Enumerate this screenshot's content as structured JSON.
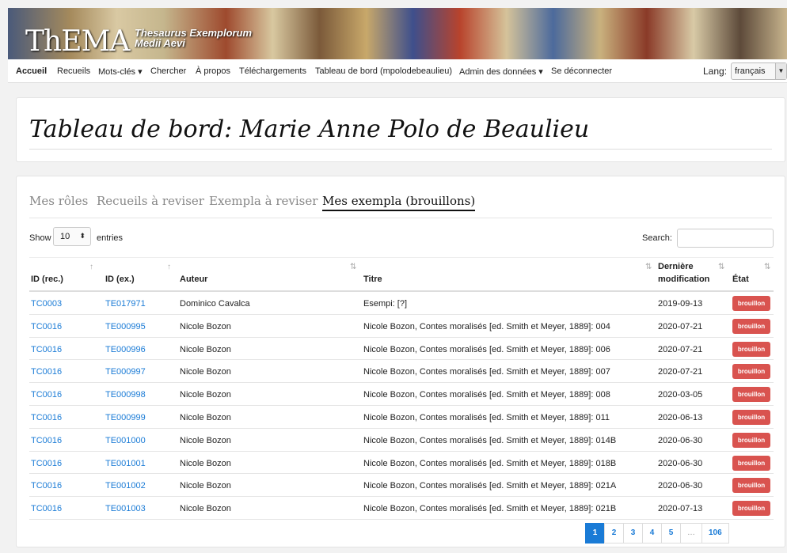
{
  "brand": {
    "logo": "ThEMA",
    "subtitle_line1": "Thesaurus Exemplorum",
    "subtitle_line2": "Medii Aevi"
  },
  "nav": {
    "items": [
      {
        "label": "Accueil",
        "active": true
      },
      {
        "label": "Recueils"
      },
      {
        "label": "Mots-clés ▾"
      },
      {
        "label": "Chercher"
      },
      {
        "label": "À propos"
      },
      {
        "label": "Téléchargements"
      },
      {
        "label": "Tableau de bord (mpolodebeaulieu)"
      },
      {
        "label": "Admin des données ▾"
      },
      {
        "label": "Se déconnecter"
      }
    ],
    "lang_label": "Lang:",
    "lang_value": "français"
  },
  "page_title": "Tableau de bord: Marie Anne Polo de Beaulieu",
  "tabs": [
    {
      "label": "Mes rôles"
    },
    {
      "label": "Recueils à reviser"
    },
    {
      "label": "Exempla à reviser"
    },
    {
      "label": "Mes exempla (brouillons)",
      "active": true
    }
  ],
  "table_controls": {
    "show_label": "Show",
    "entries_value": "10",
    "entries_label": "entries",
    "search_label": "Search:",
    "search_value": ""
  },
  "table": {
    "headers": [
      "ID (rec.)",
      "ID (ex.)",
      "Auteur",
      "Titre",
      "Dernière modification",
      "État"
    ],
    "rows": [
      {
        "rec": "TC0003",
        "ex": "TE017971",
        "auteur": "Dominico Cavalca",
        "titre": "Esempi: [?]",
        "date": "2019-09-13",
        "etat": "brouillon"
      },
      {
        "rec": "TC0016",
        "ex": "TE000995",
        "auteur": "Nicole Bozon",
        "titre": "Nicole Bozon, Contes moralisés [ed. Smith et Meyer, 1889]: 004",
        "date": "2020-07-21",
        "etat": "brouillon"
      },
      {
        "rec": "TC0016",
        "ex": "TE000996",
        "auteur": "Nicole Bozon",
        "titre": "Nicole Bozon, Contes moralisés [ed. Smith et Meyer, 1889]: 006",
        "date": "2020-07-21",
        "etat": "brouillon"
      },
      {
        "rec": "TC0016",
        "ex": "TE000997",
        "auteur": "Nicole Bozon",
        "titre": "Nicole Bozon, Contes moralisés [ed. Smith et Meyer, 1889]: 007",
        "date": "2020-07-21",
        "etat": "brouillon"
      },
      {
        "rec": "TC0016",
        "ex": "TE000998",
        "auteur": "Nicole Bozon",
        "titre": "Nicole Bozon, Contes moralisés [ed. Smith et Meyer, 1889]: 008",
        "date": "2020-03-05",
        "etat": "brouillon"
      },
      {
        "rec": "TC0016",
        "ex": "TE000999",
        "auteur": "Nicole Bozon",
        "titre": "Nicole Bozon, Contes moralisés [ed. Smith et Meyer, 1889]: 011",
        "date": "2020-06-13",
        "etat": "brouillon"
      },
      {
        "rec": "TC0016",
        "ex": "TE001000",
        "auteur": "Nicole Bozon",
        "titre": "Nicole Bozon, Contes moralisés [ed. Smith et Meyer, 1889]: 014B",
        "date": "2020-06-30",
        "etat": "brouillon"
      },
      {
        "rec": "TC0016",
        "ex": "TE001001",
        "auteur": "Nicole Bozon",
        "titre": "Nicole Bozon, Contes moralisés [ed. Smith et Meyer, 1889]: 018B",
        "date": "2020-06-30",
        "etat": "brouillon"
      },
      {
        "rec": "TC0016",
        "ex": "TE001002",
        "auteur": "Nicole Bozon",
        "titre": "Nicole Bozon, Contes moralisés [ed. Smith et Meyer, 1889]: 021A",
        "date": "2020-06-30",
        "etat": "brouillon"
      },
      {
        "rec": "TC0016",
        "ex": "TE001003",
        "auteur": "Nicole Bozon",
        "titre": "Nicole Bozon, Contes moralisés [ed. Smith et Meyer, 1889]: 021B",
        "date": "2020-07-13",
        "etat": "brouillon"
      }
    ]
  },
  "pagination": {
    "pages": [
      "1",
      "2",
      "3",
      "4",
      "5",
      "…",
      "106"
    ],
    "current": "1"
  },
  "colors": {
    "link": "#1a7bd6",
    "badge": "#d9534f",
    "page_active": "#1a7bd6"
  }
}
